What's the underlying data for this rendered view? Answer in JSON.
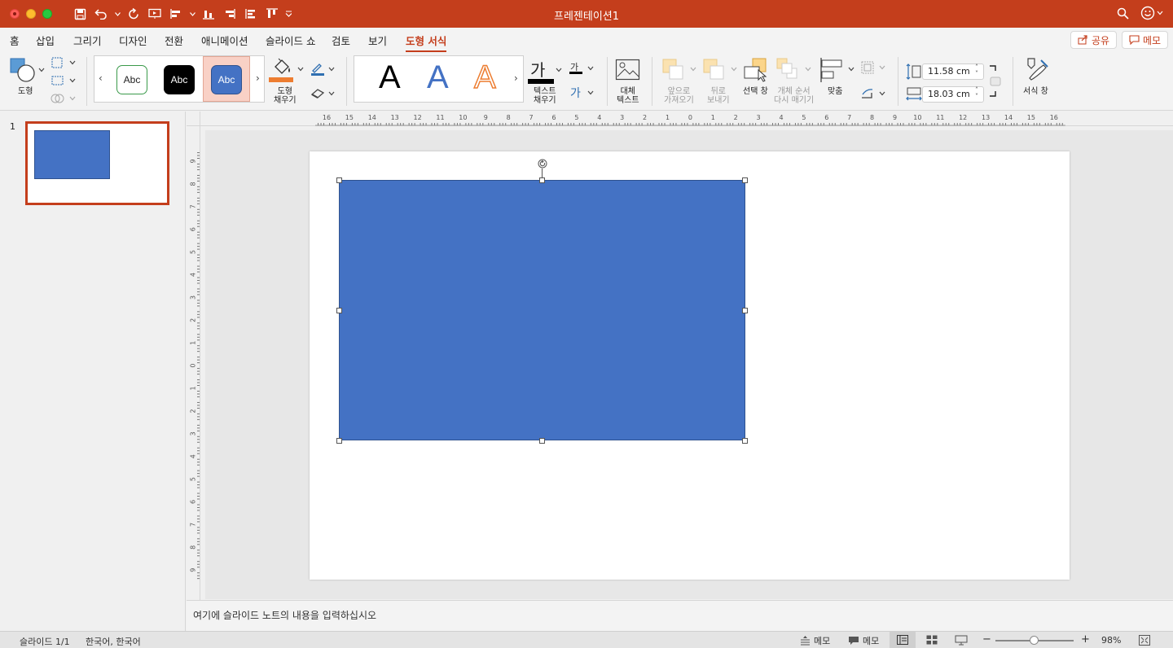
{
  "window": {
    "title": "프레젠테이션1"
  },
  "tabs": [
    {
      "label": "홈"
    },
    {
      "label": "삽입"
    },
    {
      "label": "그리기"
    },
    {
      "label": "디자인"
    },
    {
      "label": "전환"
    },
    {
      "label": "애니메이션"
    },
    {
      "label": "슬라이드 쇼"
    },
    {
      "label": "검토"
    },
    {
      "label": "보기"
    },
    {
      "label": "도형 서식"
    }
  ],
  "header_buttons": {
    "share": "공유",
    "comment": "메모"
  },
  "ribbon": {
    "shape_label": "도형",
    "shape_style_sample": "Abc",
    "fill_label_1": "도형",
    "fill_label_2": "채우기",
    "wordart_letter": "A",
    "text_fill_glyph": "가",
    "text_fill_label_1": "텍스트",
    "text_fill_label_2": "채우기",
    "alt_text_label_1": "대체",
    "alt_text_label_2": "텍스트",
    "bring_forward_1": "앞으로",
    "bring_forward_2": "가져오기",
    "send_backward_1": "뒤로",
    "send_backward_2": "보내기",
    "selection_pane": "선택 창",
    "reorder_1": "개체 순서",
    "reorder_2": "다시 매기기",
    "align": "맞춤",
    "height": "11.58 cm",
    "width": "18.03 cm",
    "format_pane": "서식 창"
  },
  "slides_pane": {
    "slide_number": "1"
  },
  "rulers": {
    "horizontal_ticks": [
      "16",
      "15",
      "14",
      "13",
      "12",
      "11",
      "10",
      "9",
      "8",
      "7",
      "6",
      "5",
      "4",
      "3",
      "2",
      "1",
      "0",
      "1",
      "2",
      "3",
      "4",
      "5",
      "6",
      "7",
      "8",
      "9",
      "10",
      "11",
      "12",
      "13",
      "14",
      "15",
      "16"
    ],
    "vertical_ticks": [
      "9",
      "8",
      "7",
      "6",
      "5",
      "4",
      "3",
      "2",
      "1",
      "0",
      "1",
      "2",
      "3",
      "4",
      "5",
      "6",
      "7",
      "8",
      "9"
    ]
  },
  "notes": {
    "placeholder": "여기에 슬라이드 노트의 내용을 입력하십시오"
  },
  "status": {
    "slide_counter": "슬라이드 1/1",
    "language": "한국어, 한국어",
    "notes_button": "메모",
    "comments_button": "메모",
    "zoom": "98%"
  },
  "colors": {
    "accent": "#c43e1c",
    "shape_fill": "#4472c4",
    "shape_border": "#2f528f"
  }
}
